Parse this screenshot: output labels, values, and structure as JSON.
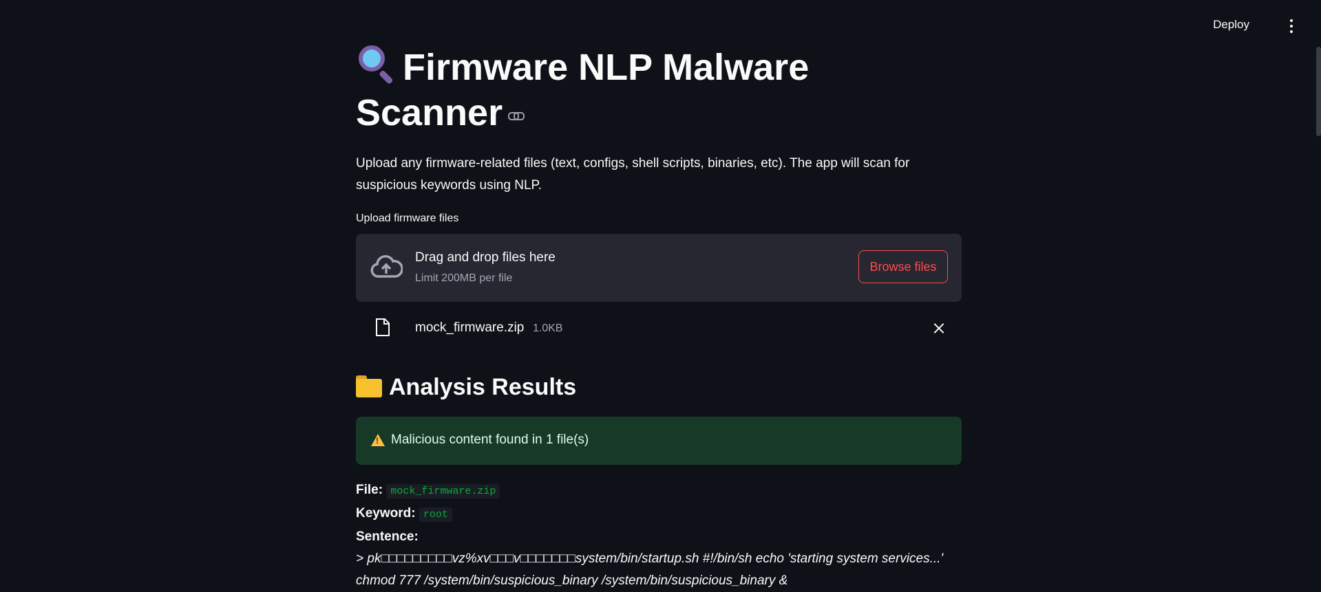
{
  "topbar": {
    "deploy_label": "Deploy",
    "menu_icon": "more-vertical-icon"
  },
  "header": {
    "title_line1": "Firmware NLP Malware",
    "title_line2": "Scanner",
    "title_icon": "magnifying-glass-icon",
    "anchor_icon": "link-icon"
  },
  "intro": {
    "text": "Upload any firmware-related files (text, configs, shell scripts, binaries, etc). The app will scan for suspicious keywords using NLP."
  },
  "uploader": {
    "label": "Upload firmware files",
    "drop_title": "Drag and drop files here",
    "drop_limit": "Limit 200MB per file",
    "browse_label": "Browse files",
    "icon": "cloud-upload-icon",
    "file": {
      "name": "mock_firmware.zip",
      "size": "1.0KB",
      "icon": "file-icon",
      "remove_icon": "close-icon"
    }
  },
  "results": {
    "heading": "Analysis Results",
    "heading_icon": "folder-icon",
    "alert_text": "Malicious content found in 1 file(s)",
    "alert_icon": "warning-icon",
    "file_label": "File:",
    "file_value": "mock_firmware.zip",
    "keyword_label": "Keyword:",
    "keyword_value": "root",
    "sentence_label": "Sentence:",
    "sentence_line1": "> pk□□□□□□□□□vz%xv□□□v□□□□□□□system/bin/startup.sh #!/bin/sh echo 'starting system services...'",
    "sentence_line2": "chmod 777 /system/bin/suspicious_binary /system/bin/suspicious_binary &"
  },
  "colors": {
    "background": "#0e1117",
    "accent": "#ff4b4b",
    "success_bg": "#173928",
    "code_green": "#09ab3b"
  }
}
